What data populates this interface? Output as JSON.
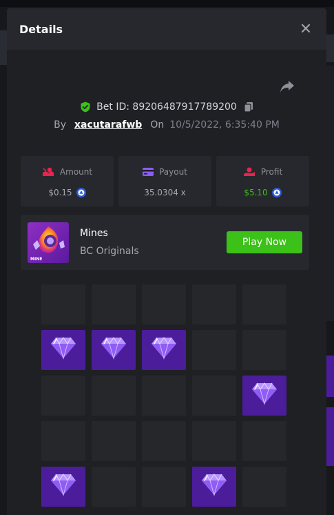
{
  "modal": {
    "title": "Details"
  },
  "bet": {
    "bet_id_text": "Bet ID: 89206487917789200",
    "by_label": "By",
    "username": "xacutarafwb",
    "on_label": "On",
    "datetime": "10/5/2022, 6:35:40 PM"
  },
  "stats": {
    "amount": {
      "label": "Amount",
      "value": "$0.15"
    },
    "payout": {
      "label": "Payout",
      "value": "35.0304 x"
    },
    "profit": {
      "label": "Profit",
      "value": "$5.10"
    }
  },
  "game": {
    "name": "Mines",
    "provider": "BC Originals",
    "thumb_label": "MINE",
    "play_label": "Play Now"
  },
  "grid": {
    "rows": 5,
    "cols": 5,
    "cells": [
      [
        "empty",
        "empty",
        "empty",
        "empty",
        "empty"
      ],
      [
        "gem",
        "gem",
        "gem",
        "empty",
        "empty"
      ],
      [
        "empty",
        "empty",
        "empty",
        "empty",
        "gem"
      ],
      [
        "empty",
        "empty",
        "empty",
        "empty",
        "empty"
      ],
      [
        "gem",
        "empty",
        "empty",
        "gem",
        "empty"
      ]
    ]
  },
  "colors": {
    "accent_green": "#3bc117",
    "gem_tile": "#4b1d9b",
    "shield_green": "#3bc117",
    "amount_icon": "#e8234f",
    "payout_icon": "#8a5cf5",
    "profit_icon": "#e8234f"
  },
  "icons": {
    "close": "close-icon",
    "share": "share-icon",
    "shield": "shield-check-icon",
    "copy": "copy-icon",
    "coin": "coin-icon",
    "gem": "diamond-icon"
  }
}
